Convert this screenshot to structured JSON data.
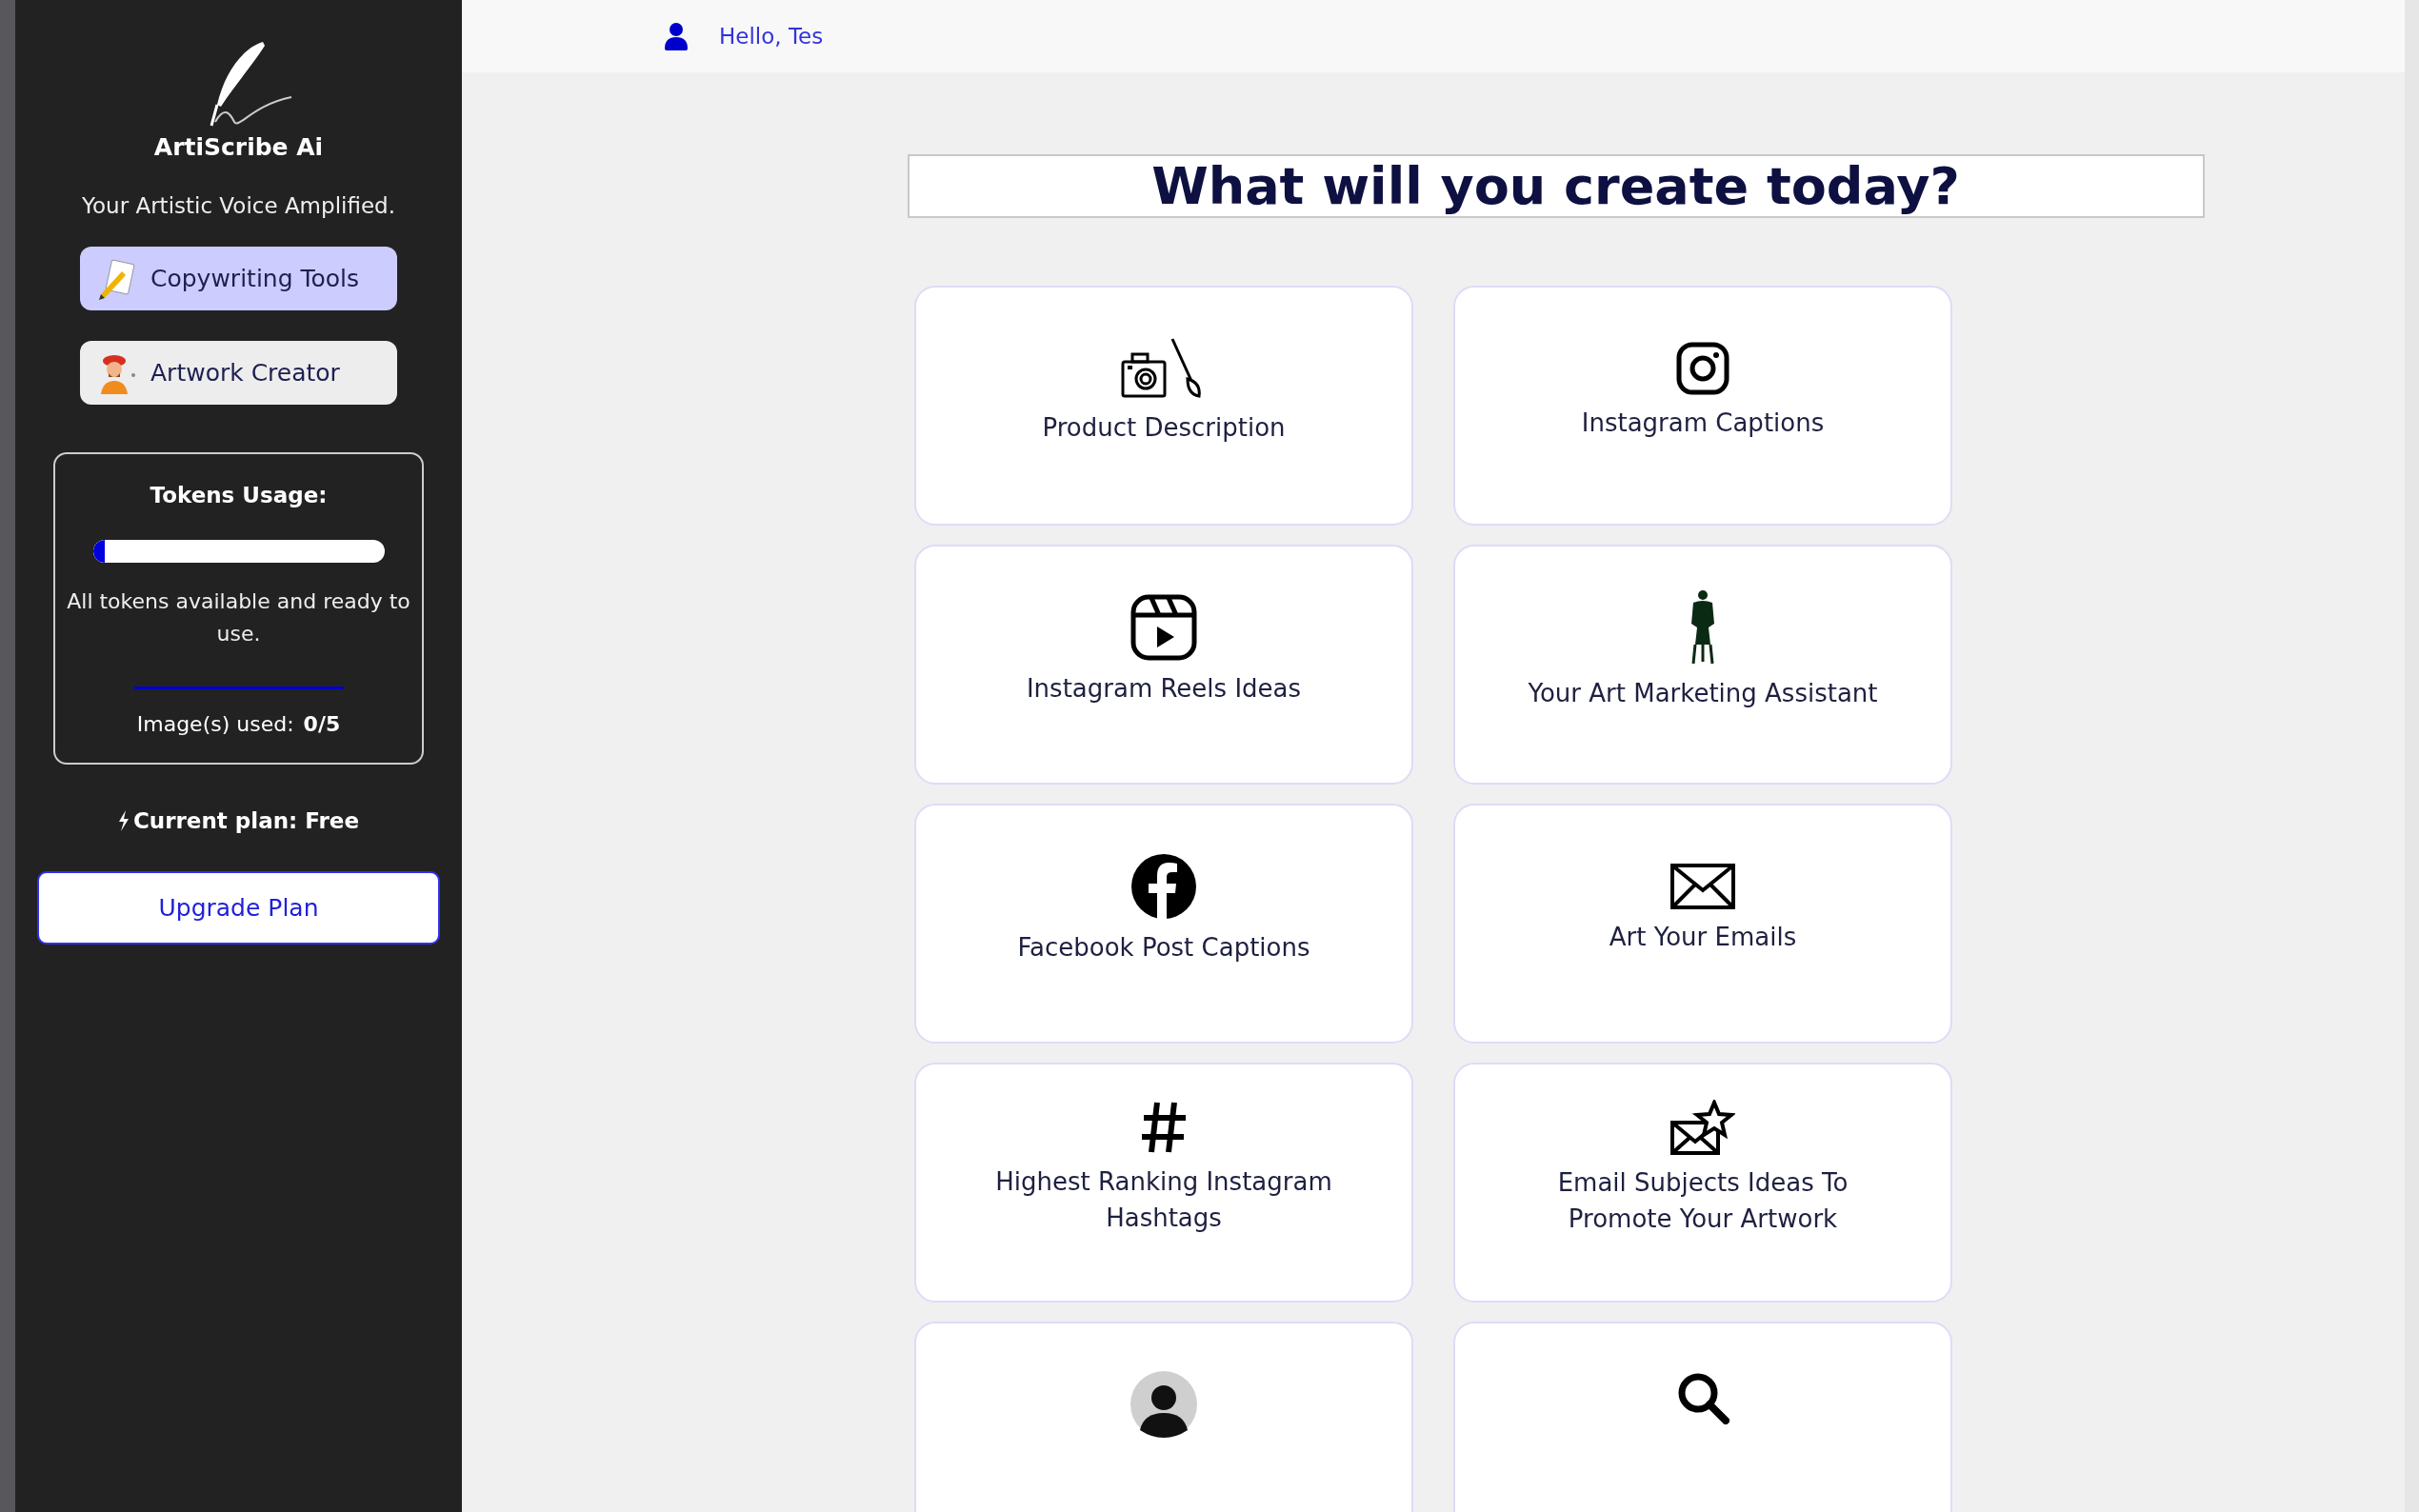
{
  "sidebar": {
    "brand": "ArtiScribe Ai",
    "tagline": "Your Artistic Voice Amplified.",
    "nav": [
      {
        "label": "Copywriting Tools",
        "selected": true
      },
      {
        "label": "Artwork Creator",
        "selected": false
      }
    ],
    "tokens": {
      "title": "Tokens Usage:",
      "level": 0.04,
      "message": "All tokens available and ready to use.",
      "images_label": "Image(s) used:",
      "images_value": "0/5"
    },
    "plan": "Current plan: Free",
    "upgrade_button": "Upgrade Plan"
  },
  "header": {
    "greeting": "Hello, Tes"
  },
  "heading": "What will you create today?",
  "cards": [
    {
      "kind": "titled",
      "title": "Product Description"
    },
    {
      "kind": "titled",
      "title": "Instagram Captions"
    },
    {
      "kind": "titled",
      "title": "Instagram Reels Ideas"
    },
    {
      "kind": "titled",
      "title": "Your Art Marketing Assistant"
    },
    {
      "kind": "titled",
      "title": "Facebook Post Captions"
    },
    {
      "kind": "titled",
      "title": "Art Your Emails"
    },
    {
      "kind": "titled",
      "title": "Highest Ranking Instagram Hashtags"
    },
    {
      "kind": "titled",
      "title": "Email Subjects Ideas To Promote Your Artwork"
    },
    {
      "kind": "cut-off"
    },
    {
      "kind": "cut-off"
    }
  ]
}
